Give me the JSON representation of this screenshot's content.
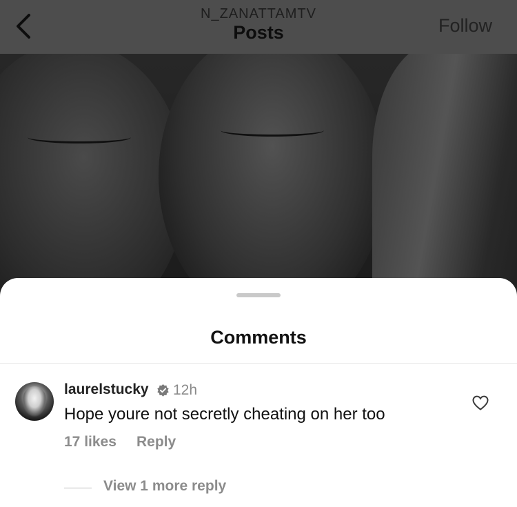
{
  "header": {
    "subtitle": "N_ZANATTAMTV",
    "title": "Posts",
    "follow_label": "Follow"
  },
  "sheet": {
    "title": "Comments"
  },
  "comments": [
    {
      "username": "laurelstucky",
      "verified": true,
      "time": "12h",
      "text": "Hope youre not secretly cheating on her too",
      "likes": "17 likes",
      "reply_label": "Reply",
      "view_replies_label": "View 1 more reply"
    }
  ],
  "icons": {
    "back": "chevron-left-icon",
    "verified": "verified-badge-icon",
    "like": "heart-outline-icon"
  },
  "colors": {
    "header_bg": "#4d4d4d",
    "sheet_bg": "#ffffff",
    "muted_text": "#8c8c8c"
  }
}
